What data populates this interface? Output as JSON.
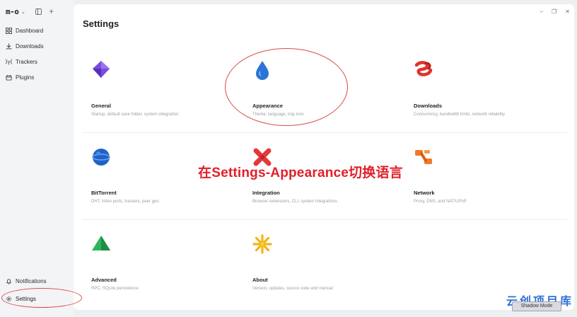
{
  "brand": {
    "logo": "m-o"
  },
  "sidebar": {
    "items": [
      {
        "label": "Dashboard",
        "icon": "grid-icon"
      },
      {
        "label": "Downloads",
        "icon": "download-icon"
      },
      {
        "label": "Trackers",
        "icon": "antenna-icon"
      },
      {
        "label": "Plugins",
        "icon": "plugin-icon"
      }
    ],
    "bottom": [
      {
        "label": "Notifications",
        "icon": "bell-icon"
      },
      {
        "label": "Settings",
        "icon": "gear-icon"
      }
    ]
  },
  "page": {
    "title": "Settings"
  },
  "cards": [
    {
      "title": "General",
      "desc": "Startup, default save folder, system integration",
      "icon": "purple-diamond-icon"
    },
    {
      "title": "Appearance",
      "desc": "Theme, language, tray icon",
      "icon": "blue-droplet-icon"
    },
    {
      "title": "Downloads",
      "desc": "Concurrency, bandwidth limits, network reliability",
      "icon": "red-coil-icon"
    },
    {
      "title": "BitTorrent",
      "desc": "DHT, listen ports, trackers, peer geo",
      "icon": "blue-globe-icon"
    },
    {
      "title": "Integration",
      "desc": "Browser extensions, CLI, system integrations",
      "icon": "red-cross-icon"
    },
    {
      "title": "Network",
      "desc": "Proxy, DNS, and NAT/UPnP",
      "icon": "orange-link-icon"
    },
    {
      "title": "Advanced",
      "desc": "RPC, SQLite persistence",
      "icon": "green-pyramid-icon"
    },
    {
      "title": "About",
      "desc": "Version, updates, source code and manual",
      "icon": "yellow-star-icon"
    }
  ],
  "overlay": {
    "caption": "在Settings-Appearance切换语言",
    "watermark": "云创项目库",
    "shadow_mode": "Shadow Mode"
  },
  "colors": {
    "annotation": "#e0202a",
    "watermark": "#2f6fd6"
  }
}
